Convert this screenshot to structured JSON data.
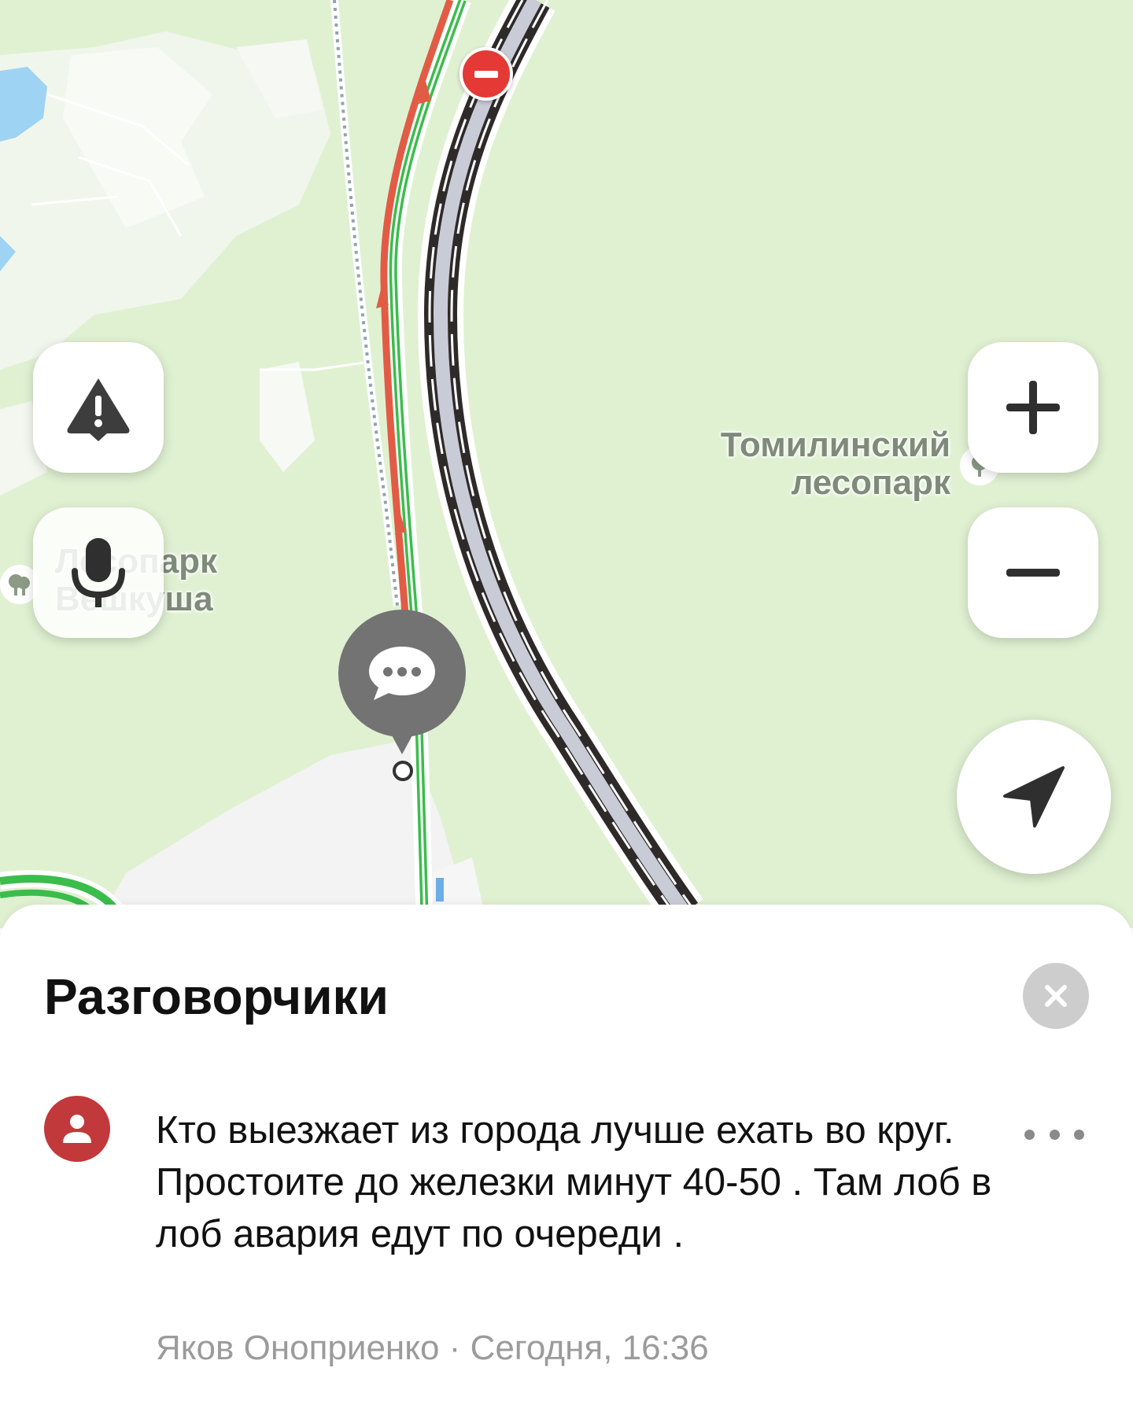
{
  "map": {
    "labels": {
      "park_east": [
        "Томилинский",
        "лесопарк"
      ],
      "park_west": [
        "Лесопарк",
        "Вешкуша"
      ]
    },
    "icons": {
      "incident": "warning-triangle-icon",
      "voice": "microphone-icon",
      "zoom_in": "plus-icon",
      "zoom_out": "minus-icon",
      "locate": "navigation-arrow-icon",
      "road_closed": "road-closed-icon",
      "chat": "chat-bubble-icon",
      "park": "tree-icon"
    },
    "colors": {
      "land": "#e0f1d2",
      "traffic_free": "#3bbd4c",
      "traffic_jam": "#e25c45",
      "highway": "#2f2a2a",
      "water": "#9fd3f3",
      "road_closed": "#e53935"
    }
  },
  "sheet": {
    "title": "Разговорчики",
    "close_icon": "close-icon",
    "comment": {
      "text": "Кто выезжает из города лучше ехать во круг. Простоите до железки минут 40-50 . Там лоб в лоб авария едут по очереди .",
      "author": "Яков Оноприенко",
      "separator": " · ",
      "time": "Сегодня, 16:36",
      "avatar_icon": "user-icon",
      "more_icon": "more-horizontal-icon"
    },
    "colors": {
      "avatar": "#c2393b",
      "close_bg": "#cdcdcd"
    }
  }
}
